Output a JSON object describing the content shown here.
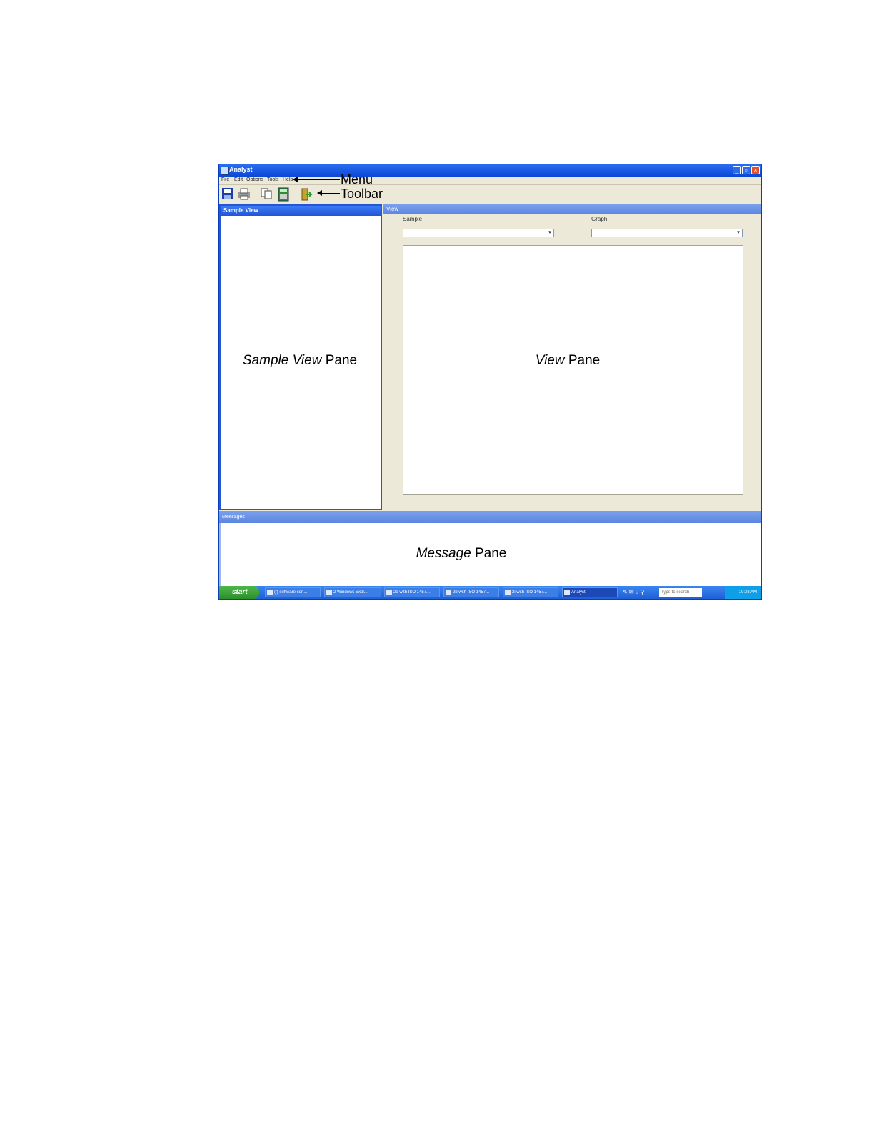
{
  "window": {
    "title": "Analyst"
  },
  "menu": {
    "items": [
      "File",
      "Edit",
      "Options",
      "Tools",
      "Help"
    ]
  },
  "annotations": {
    "menu": "Menu",
    "toolbar": "Toolbar"
  },
  "toolbar": {
    "icons": [
      "save-icon",
      "print-icon",
      "copy-icon",
      "calculator-icon",
      "exit-icon"
    ]
  },
  "sample_view": {
    "header": "Sample View",
    "label_italic": "Sample View",
    "label_rest": " Pane"
  },
  "view": {
    "header": "View",
    "sample_label": "Sample",
    "graph_label": "Graph",
    "label_italic": "View",
    "label_rest": " Pane"
  },
  "messages": {
    "header": "Messages",
    "label_italic": "Message",
    "label_rest": " Pane"
  },
  "taskbar": {
    "start": "start",
    "tasks": [
      "(f) software con...",
      "2 Windows Expl...",
      "2a with ISO 1457...",
      "2b with ISO 1457...",
      "2i with ISO 1457...",
      "Analyst"
    ],
    "search_placeholder": "Type to search",
    "clock": "10:03 AM"
  }
}
